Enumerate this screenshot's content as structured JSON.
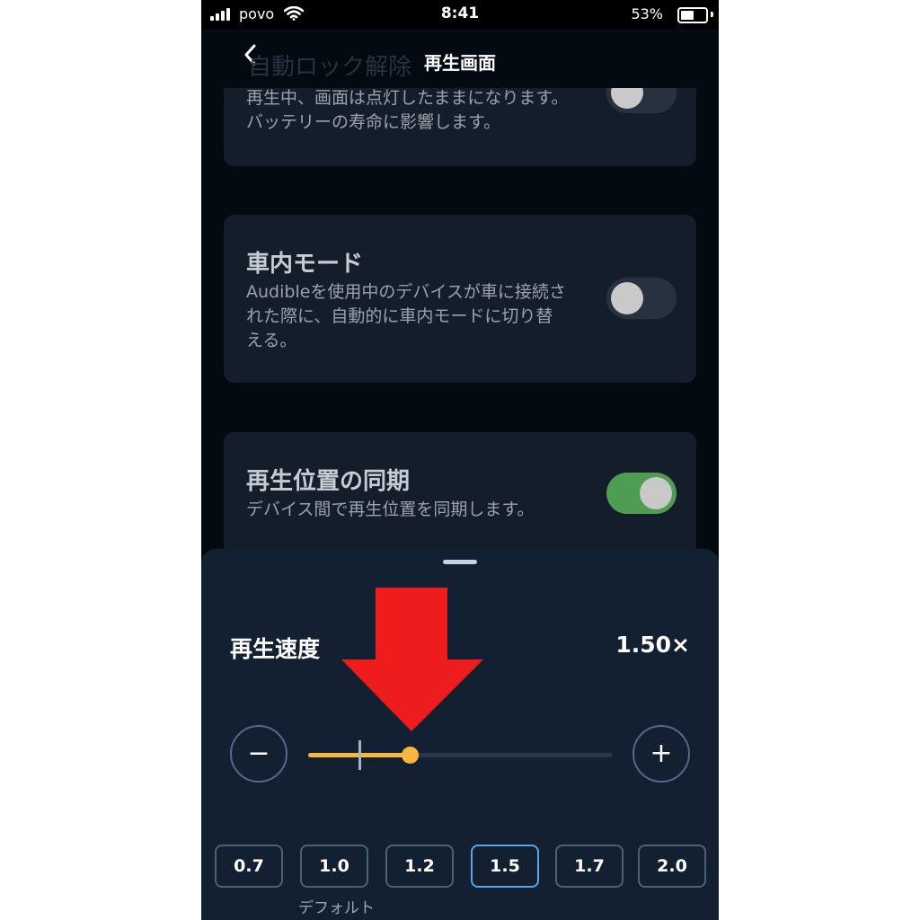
{
  "status_bar": {
    "carrier": "povo",
    "time": "8:41",
    "battery": "53%",
    "battery_level": 0.53
  },
  "header": {
    "title": "再生画面",
    "ghost_text": "自動ロック解除"
  },
  "settings": {
    "auto_lock": {
      "desc": "再生中、画面は点灯したままになります。バッテリーの寿命に影響します。",
      "enabled": false
    },
    "car_mode": {
      "title": "車内モード",
      "desc": "Audibleを使用中のデバイスが車に接続された際に、自動的に車内モードに切り替える。",
      "enabled": false
    },
    "sync": {
      "title": "再生位置の同期",
      "desc": "デバイス間で再生位置を同期します。",
      "enabled": true
    }
  },
  "speed_sheet": {
    "label": "再生速度",
    "value_text": "1.50×",
    "minus": "−",
    "plus": "+",
    "slider": {
      "min": 0.5,
      "max": 3.5,
      "value": 1.5,
      "default": 1.0
    },
    "presets": [
      "0.7",
      "1.0",
      "1.2",
      "1.5",
      "1.7",
      "2.0"
    ],
    "selected_preset": "1.5",
    "default_caption": "デフォルト"
  },
  "colors": {
    "accent": "#f6b73c",
    "toggle_on": "#4f9d52",
    "arrow": "#ee1c1c"
  }
}
